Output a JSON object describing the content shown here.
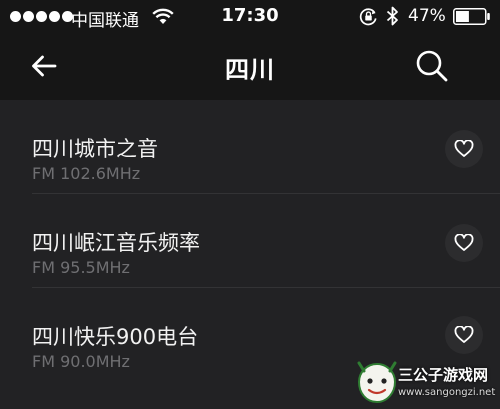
{
  "status_bar": {
    "carrier": "中国联通",
    "time": "17:30",
    "battery_percent": "47%",
    "battery_level": 0.47,
    "signal_dots": 5,
    "icons": [
      "wifi-icon",
      "orientation-lock-icon",
      "bluetooth-icon",
      "battery-icon"
    ]
  },
  "nav": {
    "title": "四川",
    "back_icon": "arrow-left-icon",
    "search_icon": "search-icon"
  },
  "stations": [
    {
      "name": "四川城市之音",
      "frequency": "FM 102.6MHz",
      "icon": "heart-outline-icon"
    },
    {
      "name": "四川岷江音乐频率",
      "frequency": "FM 95.5MHz",
      "icon": "heart-outline-icon"
    },
    {
      "name": "四川快乐900电台",
      "frequency": "FM 90.0MHz",
      "icon": "heart-outline-icon"
    }
  ],
  "watermark": {
    "title": "三公子游戏网",
    "url": "www.sangongzi.net"
  },
  "colors": {
    "background": "#222224",
    "header": "#161616",
    "text_primary": "#f2f2f2",
    "text_secondary": "#6f6f72",
    "divider": "#333335"
  }
}
